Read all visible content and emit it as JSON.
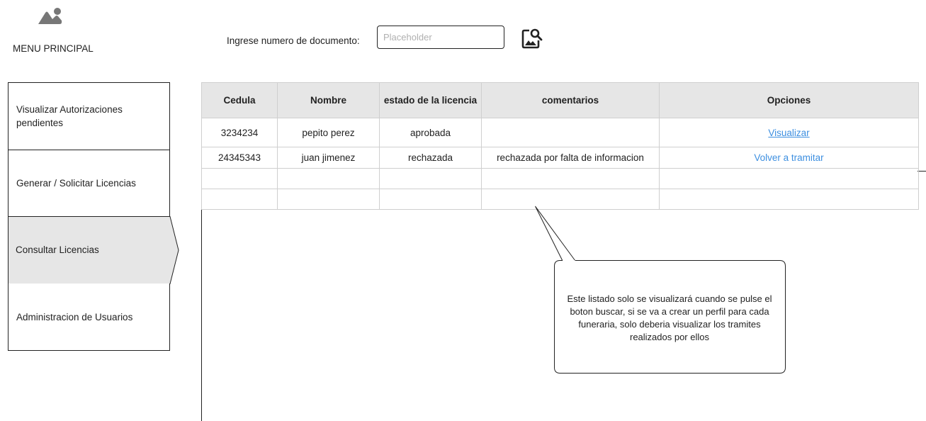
{
  "header": {
    "menu_title": "MENU PRINCIPAL",
    "logo_icon": "image-icon"
  },
  "search": {
    "label": "Ingrese numero de documento:",
    "placeholder": "Placeholder",
    "value": "",
    "button_icon": "image-search-icon"
  },
  "sidebar": {
    "items": [
      {
        "label": "Visualizar Autorizaciones pendientes",
        "active": false
      },
      {
        "label": "Generar / Solicitar Licencias",
        "active": false
      },
      {
        "label": "Consultar Licencias",
        "active": true
      },
      {
        "label": "Administracion de Usuarios",
        "active": false
      }
    ],
    "active_color": "#e6e6e6"
  },
  "table": {
    "columns": [
      "Cedula",
      "Nombre",
      "estado de la licencia",
      "comentarios",
      "Opciones"
    ],
    "rows": [
      {
        "cedula": "3234234",
        "nombre": "pepito perez",
        "estado": "aprobada",
        "comentarios": "",
        "opcion": "Visualizar"
      },
      {
        "cedula": "24345343",
        "nombre": "juan jimenez",
        "estado": "rechazada",
        "comentarios": "rechazada por falta de informacion",
        "opcion": "Volver a tramitar"
      }
    ],
    "link_color": "#3d8fe0",
    "header_bg": "#e6e6e6"
  },
  "callout": {
    "text": "Este listado solo se visualizará cuando se pulse el boton buscar, si se va a crear un perfil para cada funeraria, solo deberia visualizar los tramites realizados por ellos"
  }
}
